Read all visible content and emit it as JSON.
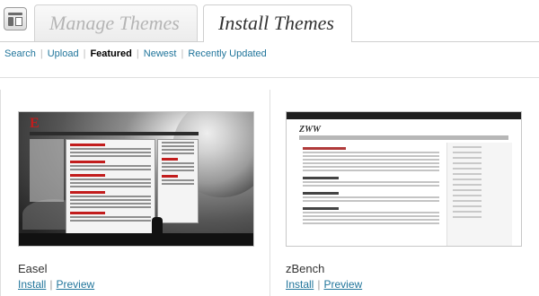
{
  "tabs": {
    "manage": "Manage Themes",
    "install": "Install Themes"
  },
  "subnav": {
    "items": [
      {
        "label": "Search"
      },
      {
        "label": "Upload"
      },
      {
        "label": "Featured"
      },
      {
        "label": "Newest"
      },
      {
        "label": "Recently Updated"
      }
    ],
    "separator": "|",
    "current": "Featured"
  },
  "themes": [
    {
      "name": "Easel",
      "install_label": "Install",
      "preview_label": "Preview",
      "link_separator": "|"
    },
    {
      "name": "zBench",
      "install_label": "Install",
      "preview_label": "Preview",
      "link_separator": "|"
    }
  ],
  "colors": {
    "link": "#21759b",
    "easel_accent": "#c21d1d"
  }
}
